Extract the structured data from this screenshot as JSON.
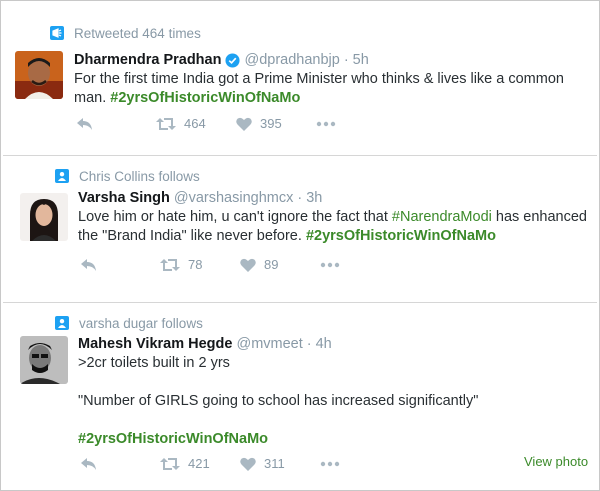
{
  "tweets": [
    {
      "context": "Retweeted 464 times",
      "name": "Dharmendra Pradhan",
      "handle": "@dpradhanbjp",
      "time": "5h",
      "verified": true,
      "text_line1": "For the first time India got a Prime Minister who thinks & lives like a common",
      "text_line2": "man.",
      "hashtag": "#2yrsOfHistoricWinOfNaMo",
      "retweets": "464",
      "likes": "395"
    },
    {
      "context": "Chris Collins follows",
      "name": "Varsha Singh",
      "handle": "@varshasinghmcx",
      "time": "3h",
      "text_line1_a": "Love him or hate him, u can't ignore the fact that",
      "text_mention": "#NarendraModi",
      "text_line1_b": "has enhanced",
      "text_line2": "the \"Brand India\" like never before.",
      "hashtag": "#2yrsOfHistoricWinOfNaMo",
      "retweets": "78",
      "likes": "89"
    },
    {
      "context": "varsha dugar follows",
      "name": "Mahesh Vikram Hegde",
      "handle": "@mvmeet",
      "time": "4h",
      "text_line1": ">2cr toilets built in 2 yrs",
      "text_line2": "\"Number of GIRLS going to school has increased significantly\"",
      "hashtag": "#2yrsOfHistoricWinOfNaMo",
      "retweets": "421",
      "likes": "311",
      "view_photo": "View photo"
    }
  ],
  "dot": "·",
  "colors": {
    "accent": "#1da1f2",
    "hashtag": "#3b8a2a",
    "muted": "#8899a6"
  }
}
